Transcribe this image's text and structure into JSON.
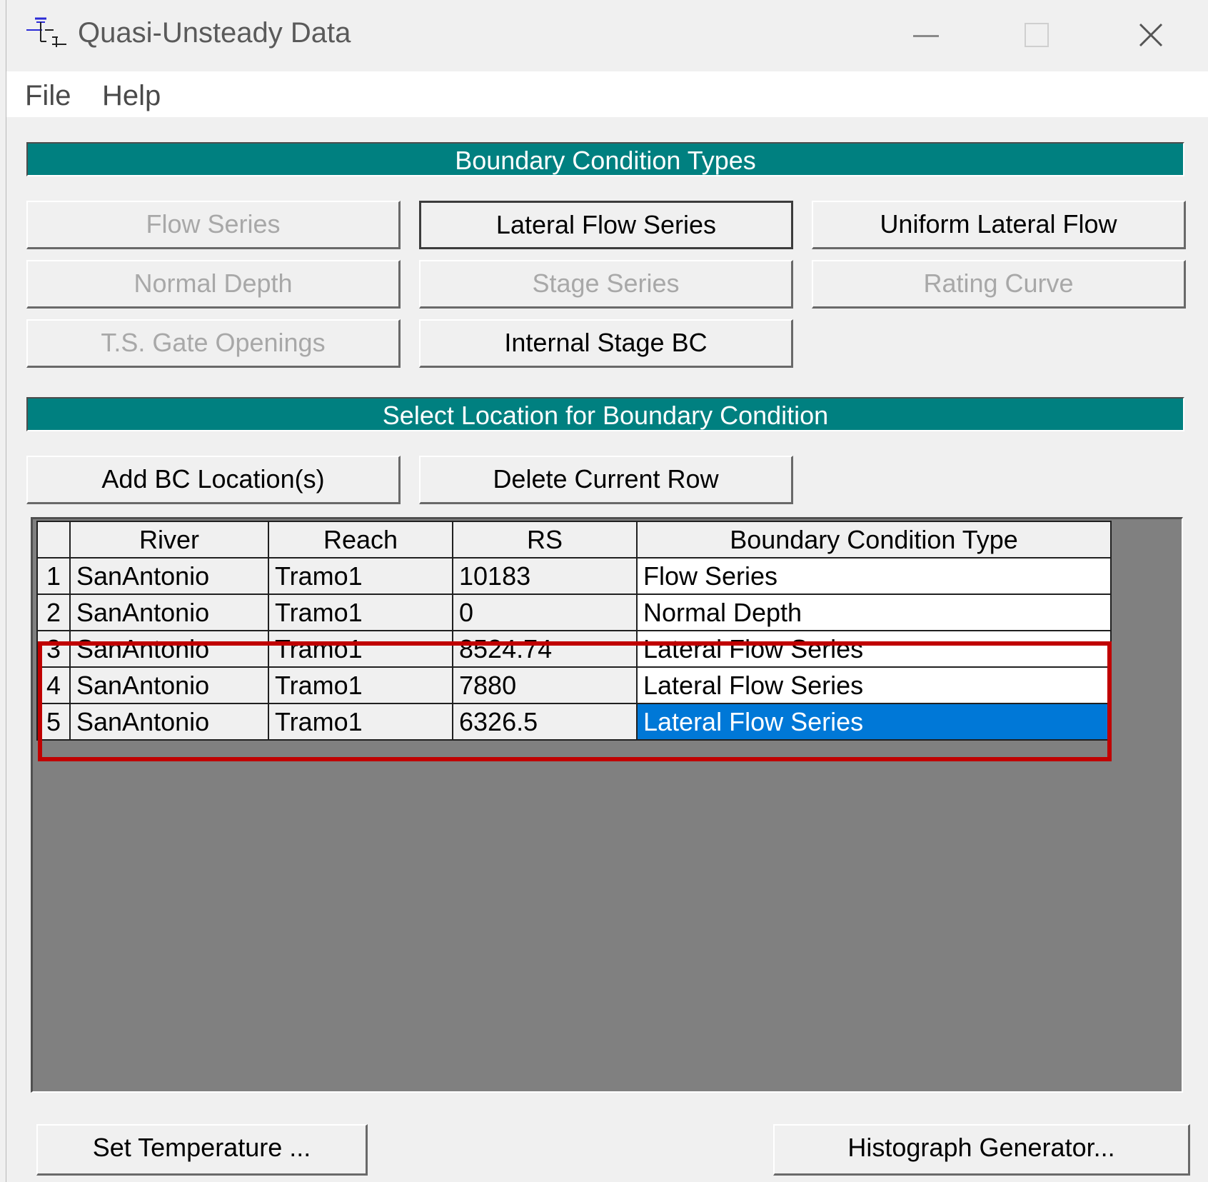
{
  "window": {
    "title": "Quasi-Unsteady Data",
    "icon": "river-schematic-icon"
  },
  "menu": {
    "file": "File",
    "help": "Help"
  },
  "bc_types": {
    "header": "Boundary Condition Types",
    "buttons": [
      {
        "label": "Flow Series",
        "enabled": false
      },
      {
        "label": "Lateral Flow Series",
        "enabled": true,
        "pressed": true
      },
      {
        "label": "Uniform Lateral Flow",
        "enabled": true
      },
      {
        "label": "Normal Depth",
        "enabled": false
      },
      {
        "label": "Stage Series",
        "enabled": false
      },
      {
        "label": "Rating Curve",
        "enabled": false
      },
      {
        "label": "T.S. Gate Openings",
        "enabled": false
      },
      {
        "label": "Internal Stage BC",
        "enabled": true
      }
    ]
  },
  "location": {
    "header": "Select Location for Boundary Condition",
    "add_button": "Add BC Location(s)",
    "delete_button": "Delete Current Row"
  },
  "table": {
    "columns": [
      "River",
      "Reach",
      "RS",
      "Boundary Condition Type"
    ],
    "rows": [
      {
        "num": "1",
        "river": "SanAntonio",
        "reach": "Tramo1",
        "rs": "10183",
        "bc": "Flow Series"
      },
      {
        "num": "2",
        "river": "SanAntonio",
        "reach": "Tramo1",
        "rs": "0",
        "bc": "Normal Depth"
      },
      {
        "num": "3",
        "river": "SanAntonio",
        "reach": "Tramo1",
        "rs": "8524.74",
        "bc": "Lateral Flow Series"
      },
      {
        "num": "4",
        "river": "SanAntonio",
        "reach": "Tramo1",
        "rs": "7880",
        "bc": "Lateral Flow Series"
      },
      {
        "num": "5",
        "river": "SanAntonio",
        "reach": "Tramo1",
        "rs": "6326.5",
        "bc": "Lateral Flow Series"
      }
    ],
    "selected_row": 5,
    "highlight_color": "#c00000",
    "selection_color": "#0078d7"
  },
  "footer": {
    "temperature_button": "Set Temperature ...",
    "histograph_button": "Histograph Generator..."
  },
  "colors": {
    "section_header": "#008080",
    "window_bg": "#f0f0f0",
    "grid_bg": "#808080"
  }
}
